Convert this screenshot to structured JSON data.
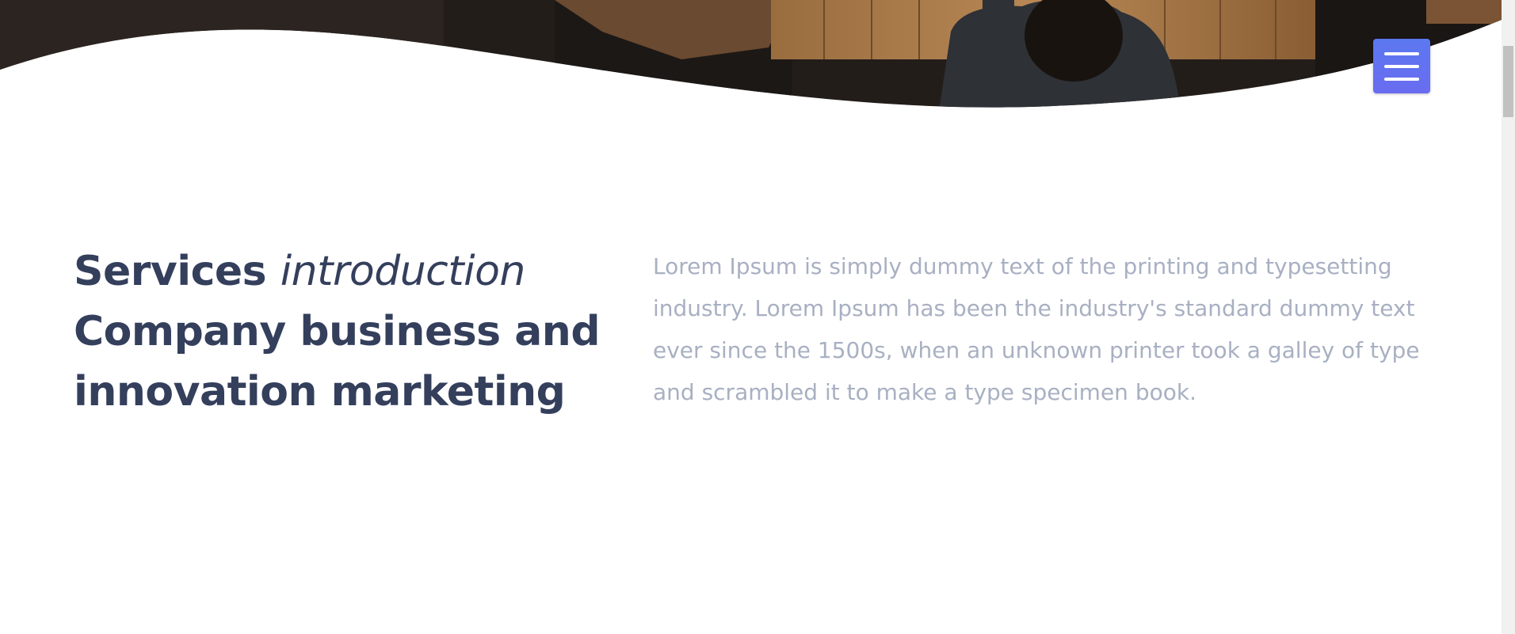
{
  "menu": {
    "icon": "hamburger-icon",
    "accent": "#6a6cf0"
  },
  "section": {
    "heading_strong": "Services ",
    "heading_italic": "introduction",
    "heading_line2": "Company business and",
    "heading_line3": "innovation marketing",
    "description_lines": [
      "Lorem Ipsum is simply dummy text of the printing and typesetting",
      "industry. Lorem Ipsum has been the industry's standard dummy text",
      "ever since the 1500s, when an unknown printer took a galley of type",
      "and scrambled it to make a type specimen book."
    ]
  },
  "colors": {
    "heading": "#343f5c",
    "body_text": "#a8b0c2",
    "background": "#ffffff"
  }
}
